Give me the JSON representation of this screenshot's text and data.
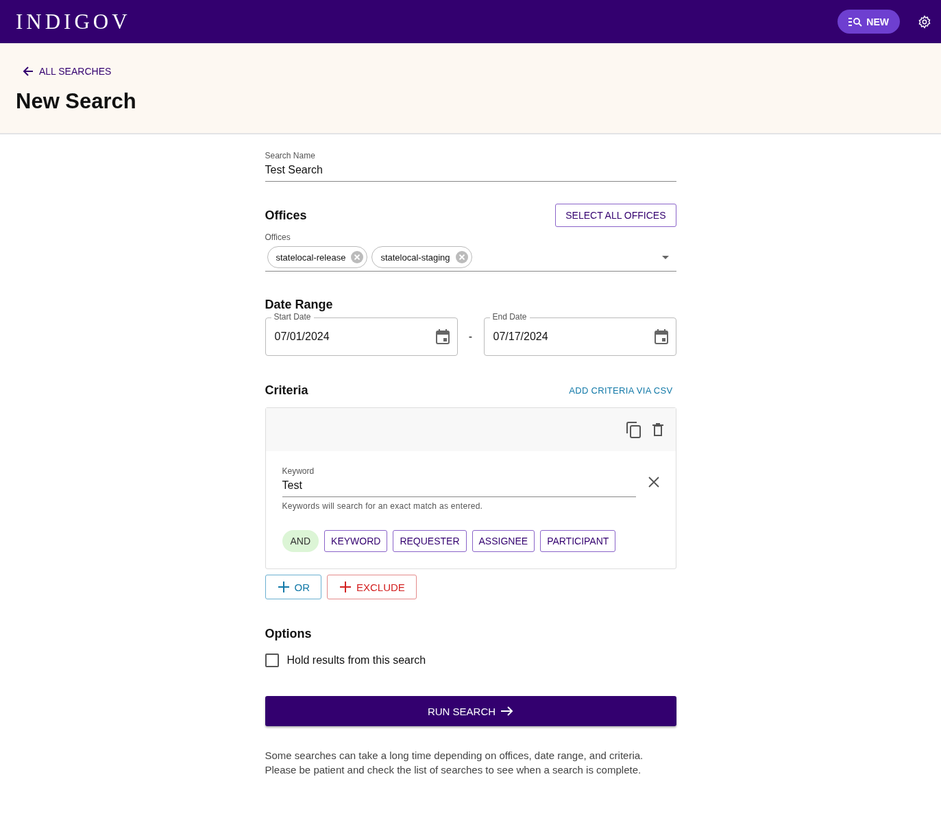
{
  "topbar": {
    "logo": "INDIGOV",
    "new_button": "NEW"
  },
  "header": {
    "back_link": "ALL SEARCHES",
    "title": "New Search"
  },
  "search_name": {
    "label": "Search Name",
    "value": "Test Search"
  },
  "offices": {
    "heading": "Offices",
    "select_all_button": "SELECT ALL OFFICES",
    "label": "Offices",
    "chips": [
      "statelocal-release",
      "statelocal-staging"
    ]
  },
  "date_range": {
    "heading": "Date Range",
    "start": {
      "label": "Start Date",
      "value": "07/01/2024"
    },
    "separator": "-",
    "end": {
      "label": "End Date",
      "value": "07/17/2024"
    }
  },
  "criteria": {
    "heading": "Criteria",
    "csv_link": "ADD CRITERIA VIA CSV",
    "groups": [
      {
        "label": "Keyword",
        "value": "Test",
        "helper": "Keywords will search for an exact match as entered.",
        "operator": "AND",
        "add_buttons": [
          "KEYWORD",
          "REQUESTER",
          "ASSIGNEE",
          "PARTICIPANT"
        ]
      }
    ],
    "or_button": "OR",
    "exclude_button": "EXCLUDE"
  },
  "options": {
    "heading": "Options",
    "items": [
      {
        "label": "Hold results from this search",
        "checked": false
      }
    ]
  },
  "run_button": "RUN SEARCH",
  "note": "Some searches can take a long time depending on offices, date range, and criteria. Please be patient and check the list of searches to see when a search is complete."
}
